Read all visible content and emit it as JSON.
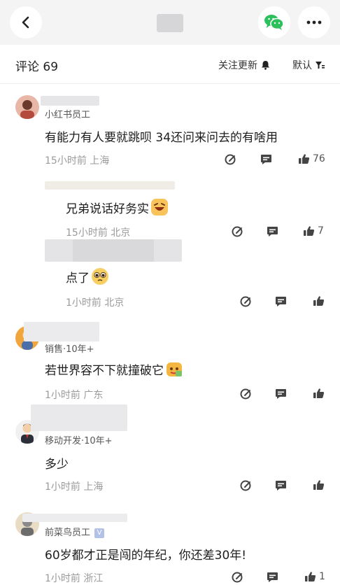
{
  "header": {
    "back_icon": "chevron-left-icon",
    "share_icon": "wechat-icon",
    "more_icon": "more-icon"
  },
  "comments_header": {
    "title": "评论 69",
    "follow_label": "关注更新",
    "sort_label": "默认"
  },
  "comments": [
    {
      "username": "小红书员工",
      "text": "有能力有人要就跳呗 34还问来问去的有啥用",
      "meta": "15小时前  上海",
      "likes": "76"
    },
    {
      "text": "兄弟说话好务实",
      "meta": "15小时前  北京",
      "likes": "7"
    },
    {
      "text": "点了",
      "meta": "1小时前  北京",
      "likes": ""
    },
    {
      "username": "销售·10年+",
      "text": "若世界容不下就撞破它",
      "meta": "1小时前  广东",
      "likes": ""
    },
    {
      "username": "移动开发·10年+",
      "text": "多少",
      "meta": "1小时前  上海",
      "likes": ""
    },
    {
      "username": "前菜鸟员工",
      "badge": "V",
      "text": "60岁都才正是闯的年纪，你还差30年!",
      "meta": "1小时前  浙江",
      "likes": "1"
    }
  ]
}
